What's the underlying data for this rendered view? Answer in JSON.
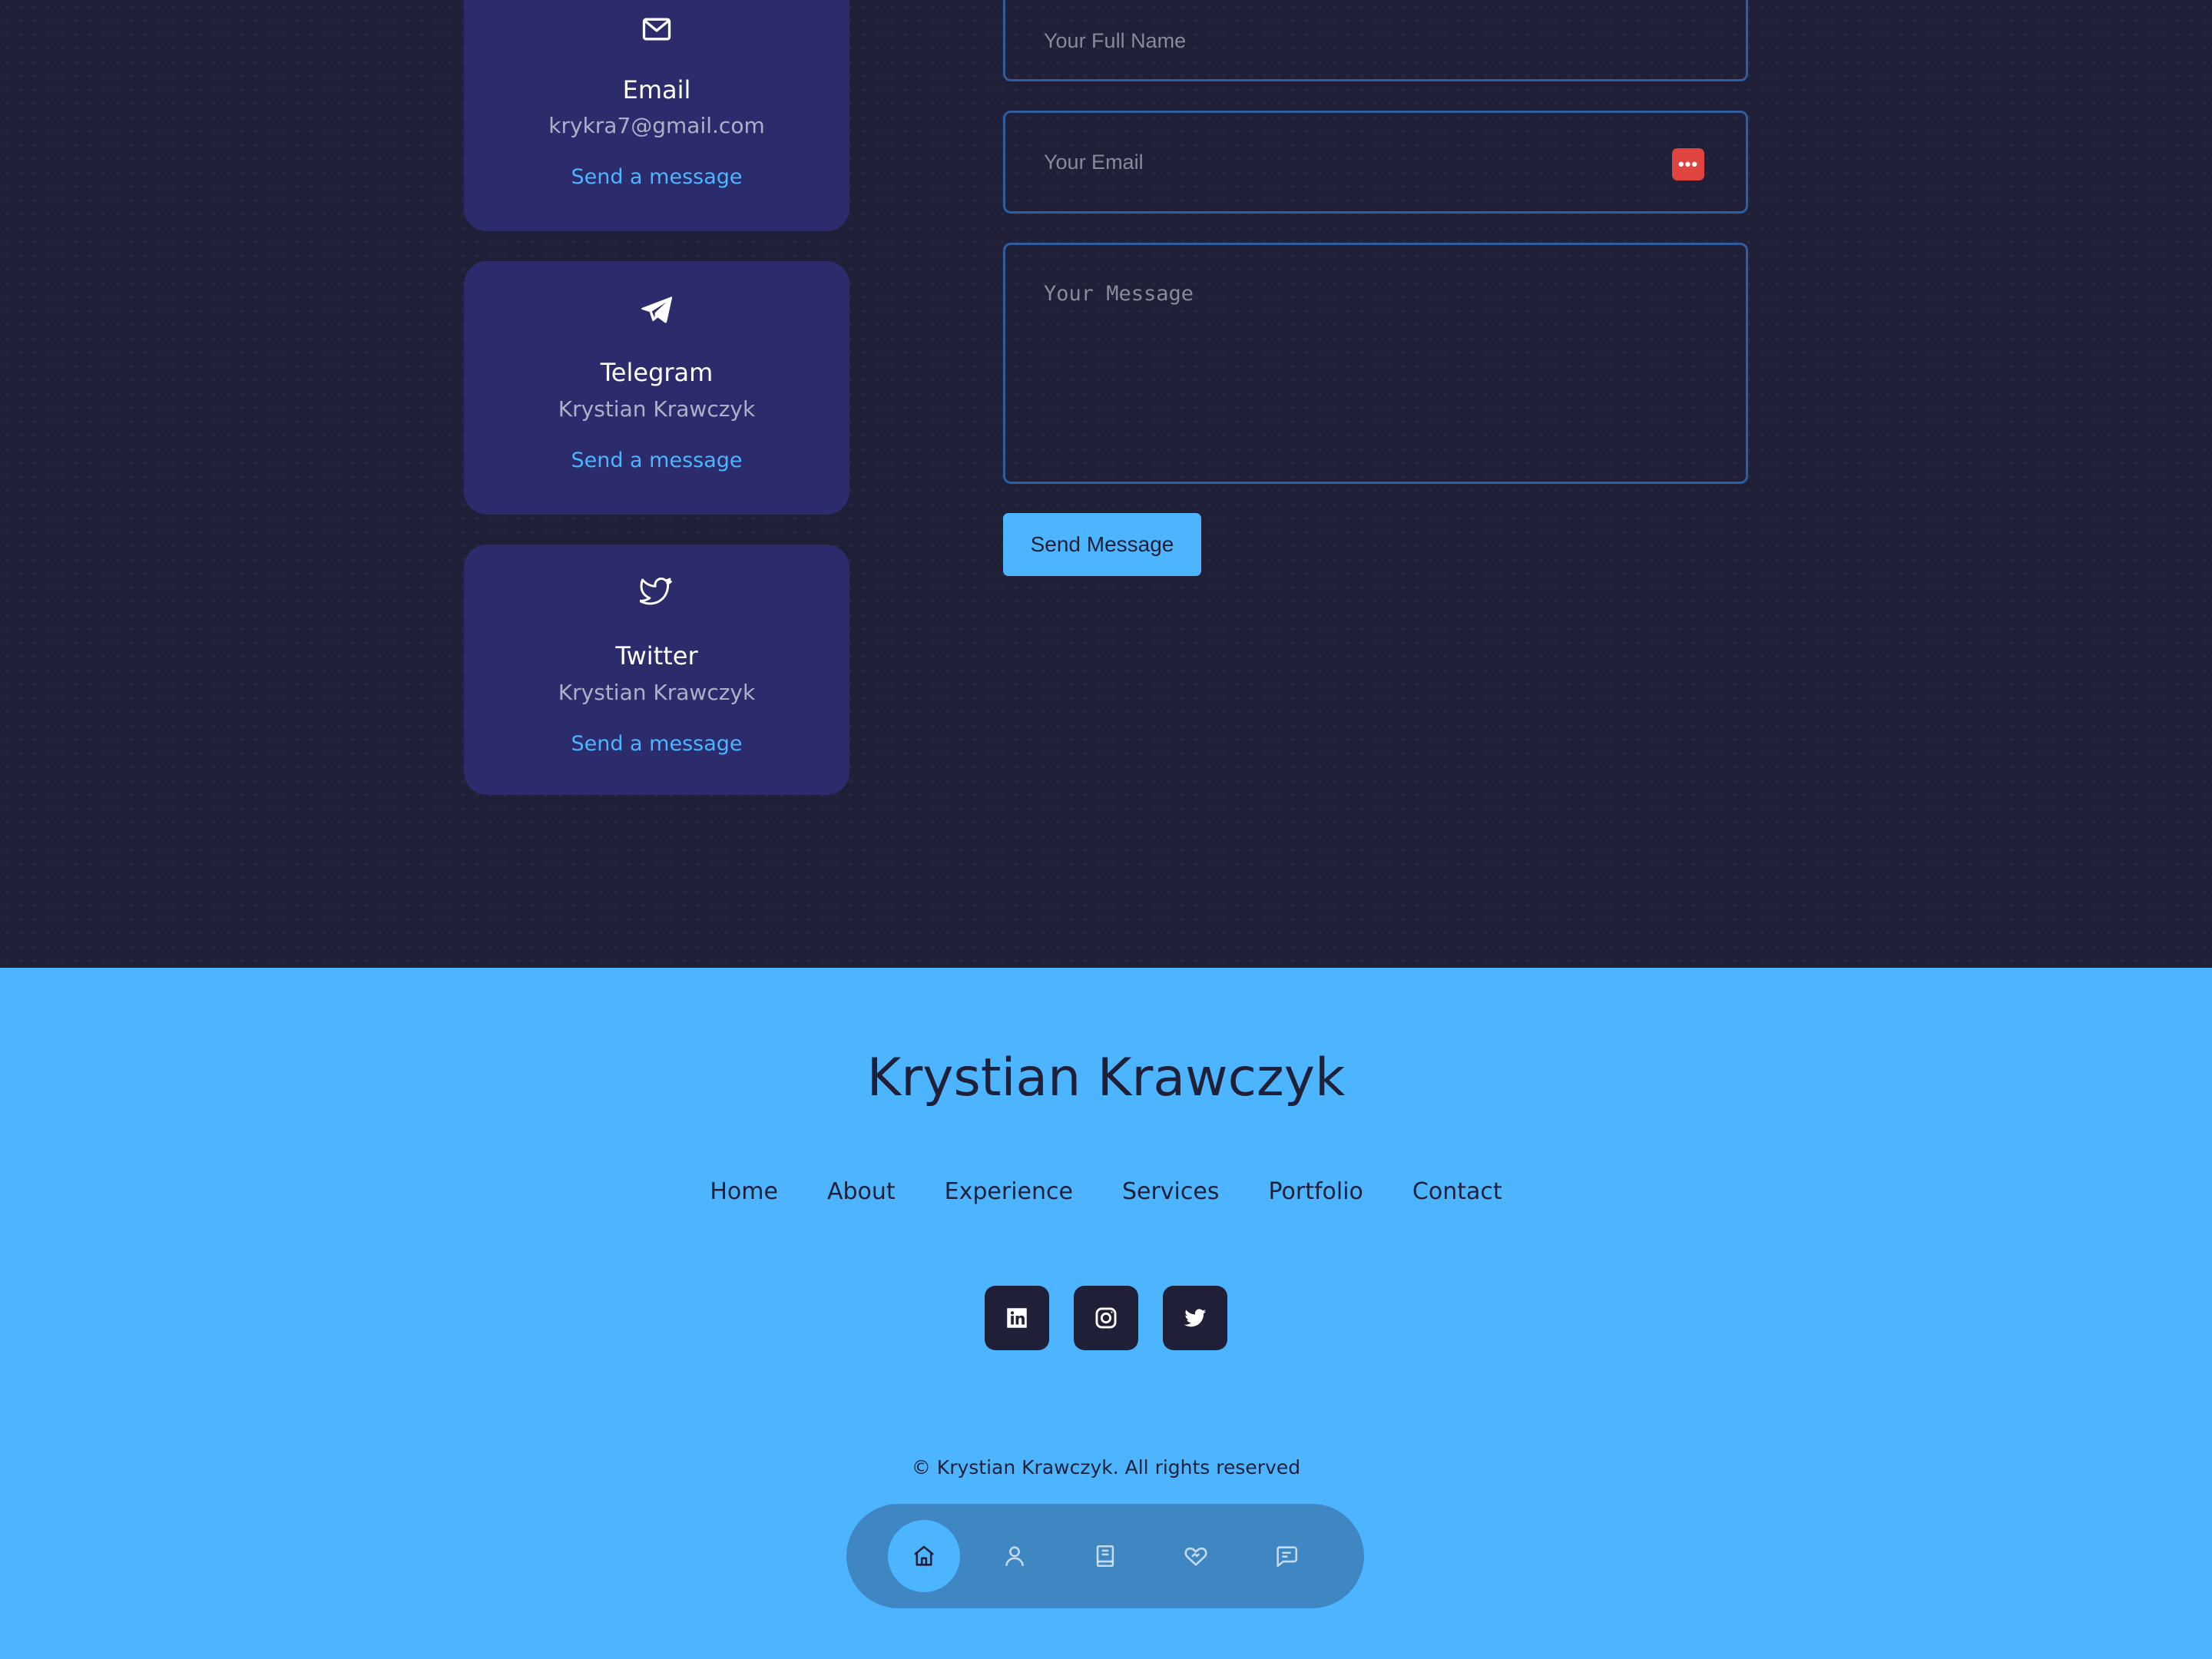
{
  "contact_options": [
    {
      "title": "Email",
      "value": "krykra7@gmail.com",
      "link": "Send a message",
      "icon": "mail-icon"
    },
    {
      "title": "Telegram",
      "value": "Krystian Krawczyk",
      "link": "Send a message",
      "icon": "telegram-icon"
    },
    {
      "title": "Twitter",
      "value": "Krystian Krawczyk",
      "link": "Send a message",
      "icon": "twitter-icon"
    }
  ],
  "form": {
    "name_placeholder": "Your Full Name",
    "email_placeholder": "Your Email",
    "message_placeholder": "Your Message",
    "submit_label": "Send Message"
  },
  "footer": {
    "logo": "Krystian Krawczyk",
    "nav": [
      "Home",
      "About",
      "Experience",
      "Services",
      "Portfolio",
      "Contact"
    ],
    "socials": [
      "linkedin-icon",
      "instagram-icon",
      "twitter-icon"
    ],
    "copyright": "© Krystian Krawczyk. All rights reserved"
  },
  "bottom_nav": {
    "items": [
      "home-icon",
      "user-icon",
      "book-icon",
      "services-icon",
      "message-icon"
    ],
    "active": "home-icon"
  },
  "colors": {
    "background": "#1f1f38",
    "card": "#2c2c6c",
    "accent": "#4db5ff",
    "field_border": "#2f5ea0",
    "password_badge": "#e0443e"
  }
}
